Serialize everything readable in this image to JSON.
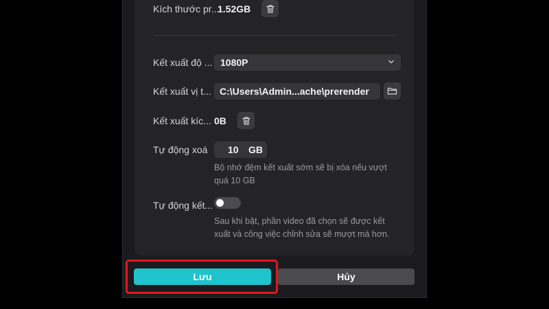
{
  "settings": {
    "cache_size": {
      "label": "Kích thước pr...",
      "value": "1.52GB"
    },
    "render_quality": {
      "label": "Kết xuất độ ...",
      "selected": "1080P"
    },
    "render_location": {
      "label": "Kết xuất vị t...",
      "path": "C:\\Users\\Admin...ache\\prerender"
    },
    "render_size": {
      "label": "Kết xuất kíc...",
      "value": "0B"
    },
    "auto_delete": {
      "label": "Tự động xoá",
      "amount": "10",
      "unit": "GB",
      "hint": "Bộ nhớ đệm kết xuất sớm sẽ bị xóa nếu vượt quá 10 GB"
    },
    "auto_render": {
      "label": "Tự động kết...",
      "enabled": false,
      "hint": "Sau khi bật, phần video đã chọn sẽ được kết xuất và công việc chỉnh sửa sẽ mượt mà hơn."
    }
  },
  "footer": {
    "save_label": "Lưu",
    "cancel_label": "Hủy"
  },
  "colors": {
    "accent": "#1fc3cc",
    "highlight": "#e0191f"
  },
  "icons": {
    "trash": "trash-icon",
    "folder": "folder-icon",
    "chevron": "chevron-down-icon"
  }
}
